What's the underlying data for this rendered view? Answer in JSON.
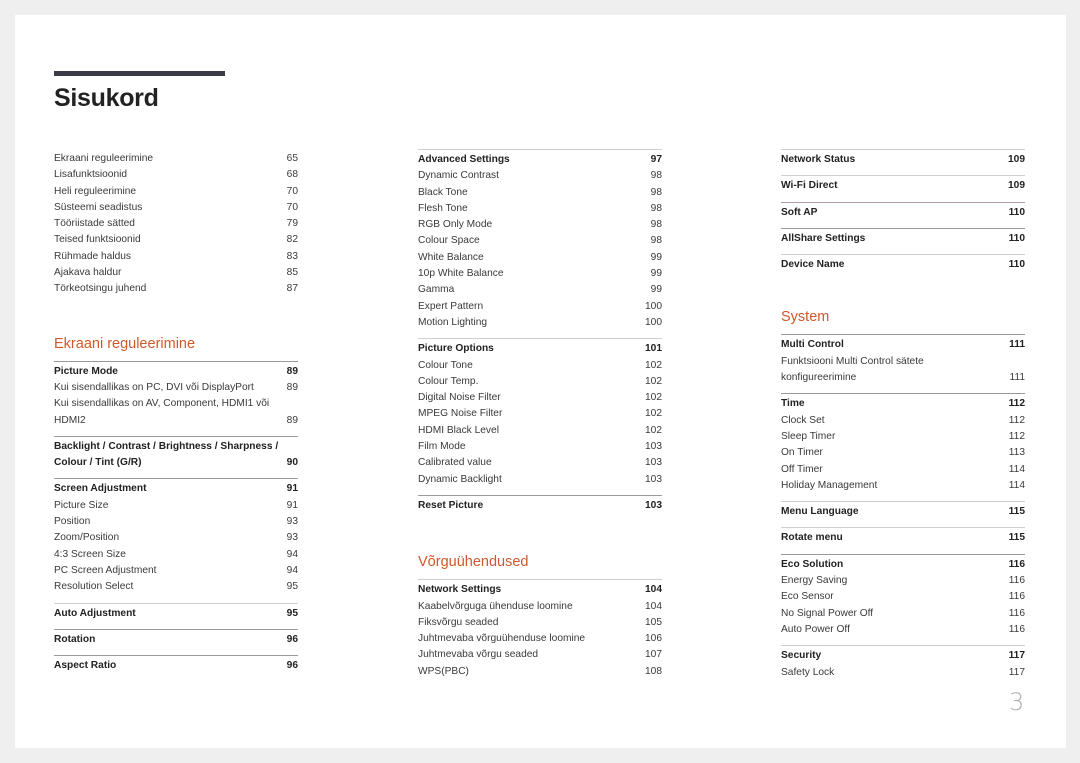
{
  "title": "Sisukord",
  "page_number": "3",
  "column1": {
    "intro": [
      {
        "label": "Ekraani reguleerimine",
        "page": "65"
      },
      {
        "label": "Lisafunktsioonid",
        "page": "68"
      },
      {
        "label": "Heli reguleerimine",
        "page": "70"
      },
      {
        "label": "Süsteemi seadistus",
        "page": "70"
      },
      {
        "label": "Tööriistade sätted",
        "page": "79"
      },
      {
        "label": "Teised funktsioonid",
        "page": "82"
      },
      {
        "label": "Rühmade haldus",
        "page": "83"
      },
      {
        "label": "Ajakava haldur",
        "page": "85"
      },
      {
        "label": "Törkeotsingu juhend",
        "page": "87"
      }
    ],
    "section_title": "Ekraani reguleerimine",
    "groups": [
      {
        "label": "Picture Mode",
        "page": "89",
        "items": [
          {
            "label": "Kui sisendallikas on PC, DVI või DisplayPort",
            "page": "89"
          },
          {
            "label": "Kui sisendallikas on AV, Component, HDMI1 või HDMI2",
            "page": "89"
          }
        ]
      },
      {
        "label": "Backlight / Contrast / Brightness / Sharpness / Colour / Tint (G/R)",
        "page": "90",
        "items": []
      },
      {
        "label": "Screen Adjustment",
        "page": "91",
        "items": [
          {
            "label": "Picture Size",
            "page": "91"
          },
          {
            "label": "Position",
            "page": "93"
          },
          {
            "label": "Zoom/Position",
            "page": "93"
          },
          {
            "label": "4:3 Screen Size",
            "page": "94"
          },
          {
            "label": "PC Screen Adjustment",
            "page": "94"
          },
          {
            "label": "Resolution Select",
            "page": "95"
          }
        ]
      },
      {
        "label": "Auto Adjustment",
        "page": "95",
        "items": []
      },
      {
        "label": "Rotation",
        "page": "96",
        "items": []
      },
      {
        "label": "Aspect Ratio",
        "page": "96",
        "items": []
      }
    ]
  },
  "column2": {
    "groups": [
      {
        "label": "Advanced Settings",
        "page": "97",
        "items": [
          {
            "label": "Dynamic Contrast",
            "page": "98"
          },
          {
            "label": "Black Tone",
            "page": "98"
          },
          {
            "label": "Flesh Tone",
            "page": "98"
          },
          {
            "label": "RGB Only Mode",
            "page": "98"
          },
          {
            "label": "Colour Space",
            "page": "98"
          },
          {
            "label": "White Balance",
            "page": "99"
          },
          {
            "label": "10p White Balance",
            "page": "99"
          },
          {
            "label": "Gamma",
            "page": "99"
          },
          {
            "label": "Expert Pattern",
            "page": "100"
          },
          {
            "label": "Motion Lighting",
            "page": "100"
          }
        ]
      },
      {
        "label": "Picture Options",
        "page": "101",
        "items": [
          {
            "label": "Colour Tone",
            "page": "102"
          },
          {
            "label": "Colour Temp.",
            "page": "102"
          },
          {
            "label": "Digital Noise Filter",
            "page": "102"
          },
          {
            "label": "MPEG Noise Filter",
            "page": "102"
          },
          {
            "label": "HDMI Black Level",
            "page": "102"
          },
          {
            "label": "Film Mode",
            "page": "103"
          },
          {
            "label": "Calibrated value",
            "page": "103"
          },
          {
            "label": "Dynamic Backlight",
            "page": "103"
          }
        ]
      },
      {
        "label": "Reset Picture",
        "page": "103",
        "items": []
      }
    ],
    "section_title": "Võrguühendused",
    "section_groups": [
      {
        "label": "Network Settings",
        "page": "104",
        "items": [
          {
            "label": "Kaabelvõrguga ühenduse loomine",
            "page": "104"
          },
          {
            "label": "Fiksvõrgu seaded",
            "page": "105"
          },
          {
            "label": "Juhtmevaba võrguühenduse loomine",
            "page": "106"
          },
          {
            "label": "Juhtmevaba võrgu seaded",
            "page": "107"
          },
          {
            "label": "WPS(PBC)",
            "page": "108"
          }
        ]
      }
    ]
  },
  "column3": {
    "groups": [
      {
        "label": "Network Status",
        "page": "109",
        "items": []
      },
      {
        "label": "Wi-Fi Direct",
        "page": "109",
        "items": []
      },
      {
        "label": "Soft AP",
        "page": "110",
        "items": []
      },
      {
        "label": "AllShare Settings",
        "page": "110",
        "items": []
      },
      {
        "label": "Device Name",
        "page": "110",
        "items": []
      }
    ],
    "section_title": "System",
    "section_groups": [
      {
        "label": "Multi Control",
        "page": "111",
        "items": [
          {
            "label": "Funktsiooni Multi Control sätete konfigureerimine",
            "page": "111"
          }
        ]
      },
      {
        "label": "Time",
        "page": "112",
        "items": [
          {
            "label": "Clock Set",
            "page": "112"
          },
          {
            "label": "Sleep Timer",
            "page": "112"
          },
          {
            "label": "On Timer",
            "page": "113"
          },
          {
            "label": "Off Timer",
            "page": "114"
          },
          {
            "label": "Holiday Management",
            "page": "114"
          }
        ]
      },
      {
        "label": "Menu Language",
        "page": "115",
        "items": []
      },
      {
        "label": "Rotate menu",
        "page": "115",
        "items": []
      },
      {
        "label": "Eco Solution",
        "page": "116",
        "items": [
          {
            "label": "Energy Saving",
            "page": "116"
          },
          {
            "label": "Eco Sensor",
            "page": "116"
          },
          {
            "label": "No Signal Power Off",
            "page": "116"
          },
          {
            "label": "Auto Power Off",
            "page": "116"
          }
        ]
      },
      {
        "label": "Security",
        "page": "117",
        "items": [
          {
            "label": "Safety Lock",
            "page": "117"
          }
        ]
      }
    ]
  },
  "colors": {
    "section_title": "#d0582a",
    "title_bar": "#3b3b48"
  }
}
